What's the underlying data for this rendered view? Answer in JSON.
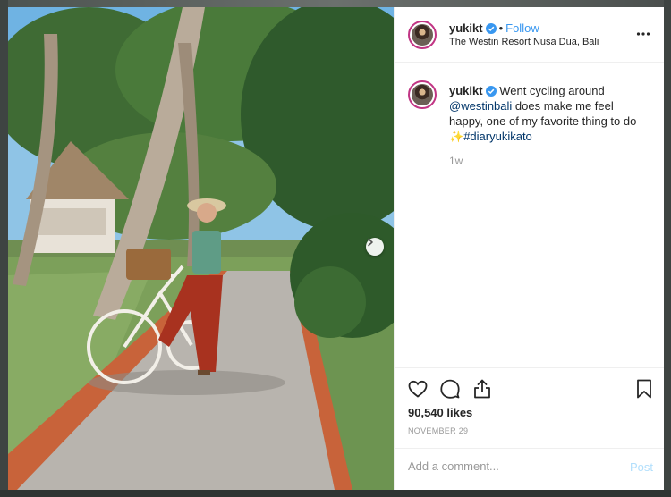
{
  "post": {
    "username": "yukikt",
    "separator": "•",
    "follow_label": "Follow",
    "location": "The Westin Resort Nusa Dua, Bali"
  },
  "caption": {
    "username": "yukikt",
    "text_before_mention": "Went cycling around",
    "mention": "@westinbali",
    "text_after_mention": "does make me feel happy, one of my favorite thing to do",
    "emoji": "✨",
    "hashtag": "#diaryukikato",
    "time": "1w"
  },
  "engagement": {
    "likes": "90,540 likes",
    "date": "NOVEMBER 29"
  },
  "comment": {
    "placeholder": "Add a comment...",
    "post_label": "Post"
  },
  "icons": {
    "verified": "verified-badge-icon",
    "more": "more-horizontal-icon",
    "like": "heart-icon",
    "comment": "comment-bubble-icon",
    "share": "share-icon",
    "save": "bookmark-icon",
    "next": "chevron-right-icon"
  },
  "colors": {
    "link": "#003569",
    "follow": "#3897f0",
    "verified": "#3897f0",
    "post_disabled": "#b2dffc"
  }
}
